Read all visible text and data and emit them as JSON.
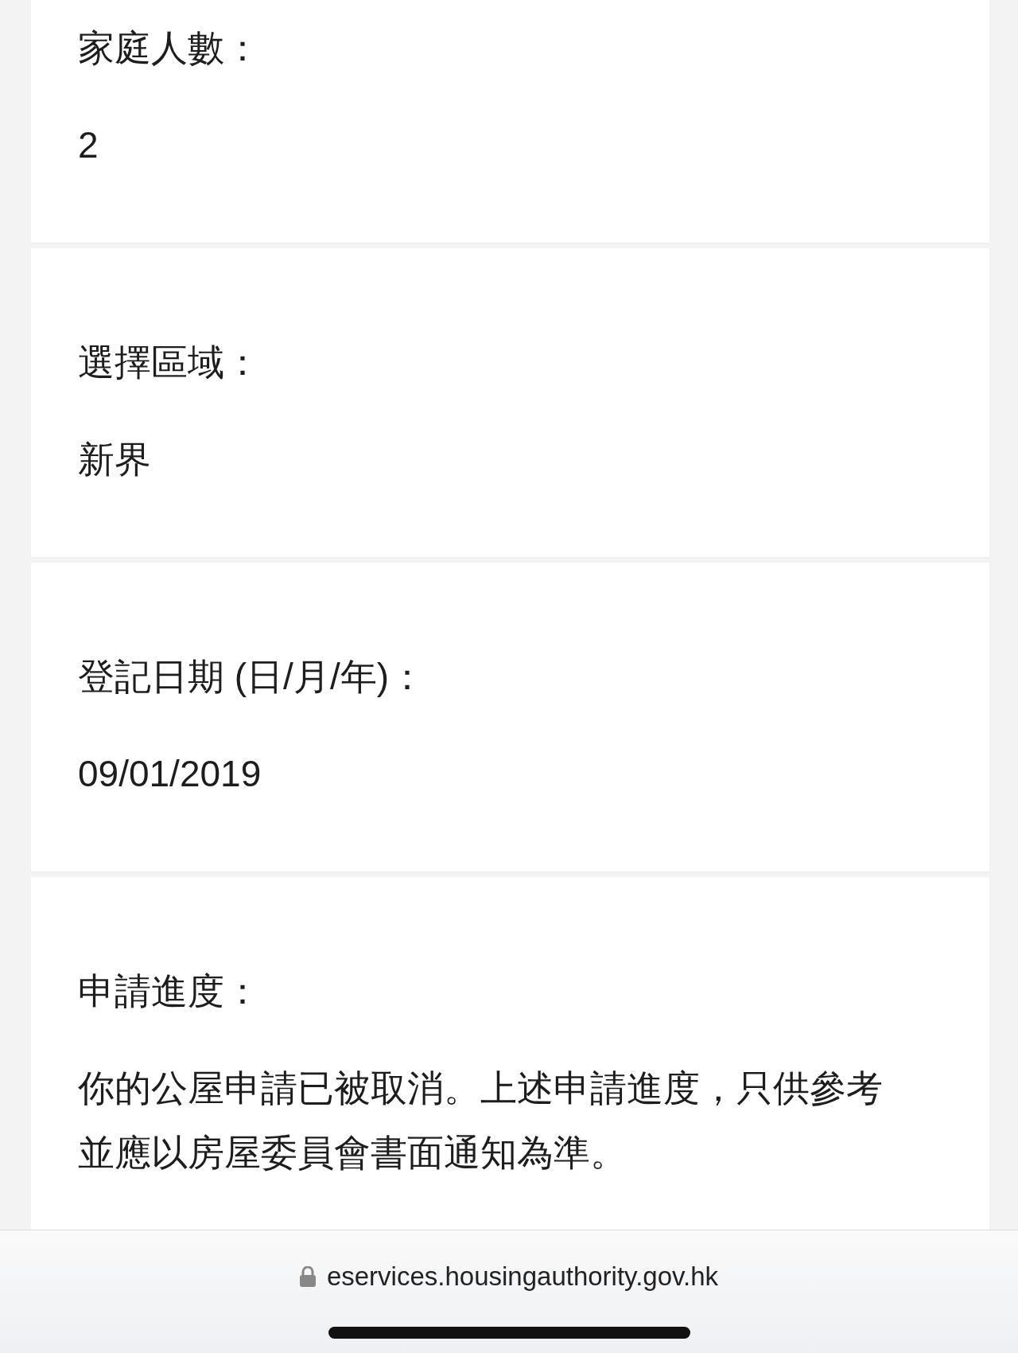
{
  "fields": [
    {
      "label": "家庭人數：",
      "value": "2"
    },
    {
      "label": "選擇區域：",
      "value": "新界"
    },
    {
      "label": "登記日期 (日/月/年)：",
      "value": "09/01/2019"
    },
    {
      "label": "申請進度：",
      "value": "你的公屋申請已被取消。上述申請進度，只供參考並應以房屋委員會書面通知為準。"
    }
  ],
  "browser_bar": {
    "url": "eservices.housingauthority.gov.hk"
  }
}
